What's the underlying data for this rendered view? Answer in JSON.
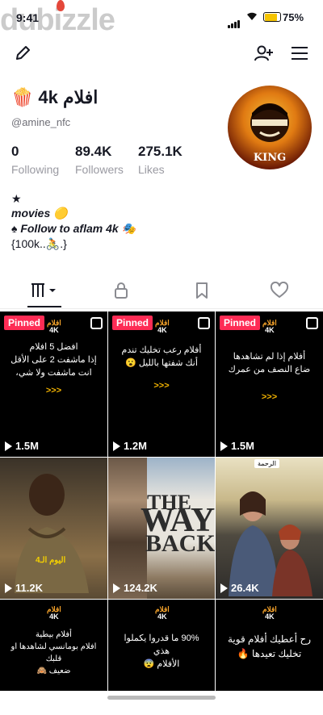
{
  "status_bar": {
    "time": "9:41",
    "battery": "75%"
  },
  "watermark": "dubizzle",
  "profile": {
    "name": "افلام 4k",
    "name_emoji": "🍿",
    "handle": "@amine_nfc",
    "avatar_text": "KING",
    "stats": [
      {
        "value": "0",
        "label": "Following"
      },
      {
        "value": "89.4K",
        "label": "Followers"
      },
      {
        "value": "275.1K",
        "label": "Likes"
      }
    ],
    "bio": [
      "★",
      "movies 🟡",
      "♠ Follow to aflam 4k 🎭",
      "{100k..🚴.}"
    ]
  },
  "tabs": [
    "videos",
    "private",
    "saved",
    "liked"
  ],
  "grid": [
    {
      "pinned": "Pinned",
      "text": "افضل 5 افلام\nإذا ماشفت 2 على الأقل\nانت ماشفت ولا شي،",
      "arrows": ">>>",
      "views": "1.5M",
      "logo": "افلام",
      "logo2": "4K"
    },
    {
      "pinned": "Pinned",
      "text": "أفلام رعب تخليك تندم\nأنك شفتها بالليل 😮",
      "arrows": ">>>",
      "views": "1.2M",
      "logo": "افلام",
      "logo2": "4K"
    },
    {
      "pinned": "Pinned",
      "text": "أفلام إذا لم تشاهدها\nضاع النصف من عمرك",
      "arrows": ">>>",
      "views": "1.5M",
      "logo": "افلام",
      "logo2": "4K"
    },
    {
      "caption": "اليوم الـ4",
      "views": "11.2K"
    },
    {
      "title1": "THE",
      "title2": "WAY",
      "title3": "BACK",
      "views": "124.2K"
    },
    {
      "badge": "الرحمة",
      "views": "26.4K"
    },
    {
      "text": "أفلام بيطية\nافلام بومانسي لشاهدها او قلبك\nضعيف 🙈",
      "logo": "افلام",
      "logo2": "4K"
    },
    {
      "text": "90% ما قدروا يكملوا هذي\nالأفلام 😨",
      "logo": "افلام",
      "logo2": "4K"
    },
    {
      "text": "رح أعطيك أفلام قوية\nتخليك تعيدها 🔥",
      "logo": "افلام",
      "logo2": "4K"
    }
  ],
  "colors": {
    "pinned": "#fe2c55",
    "accent": "#f4b400"
  }
}
